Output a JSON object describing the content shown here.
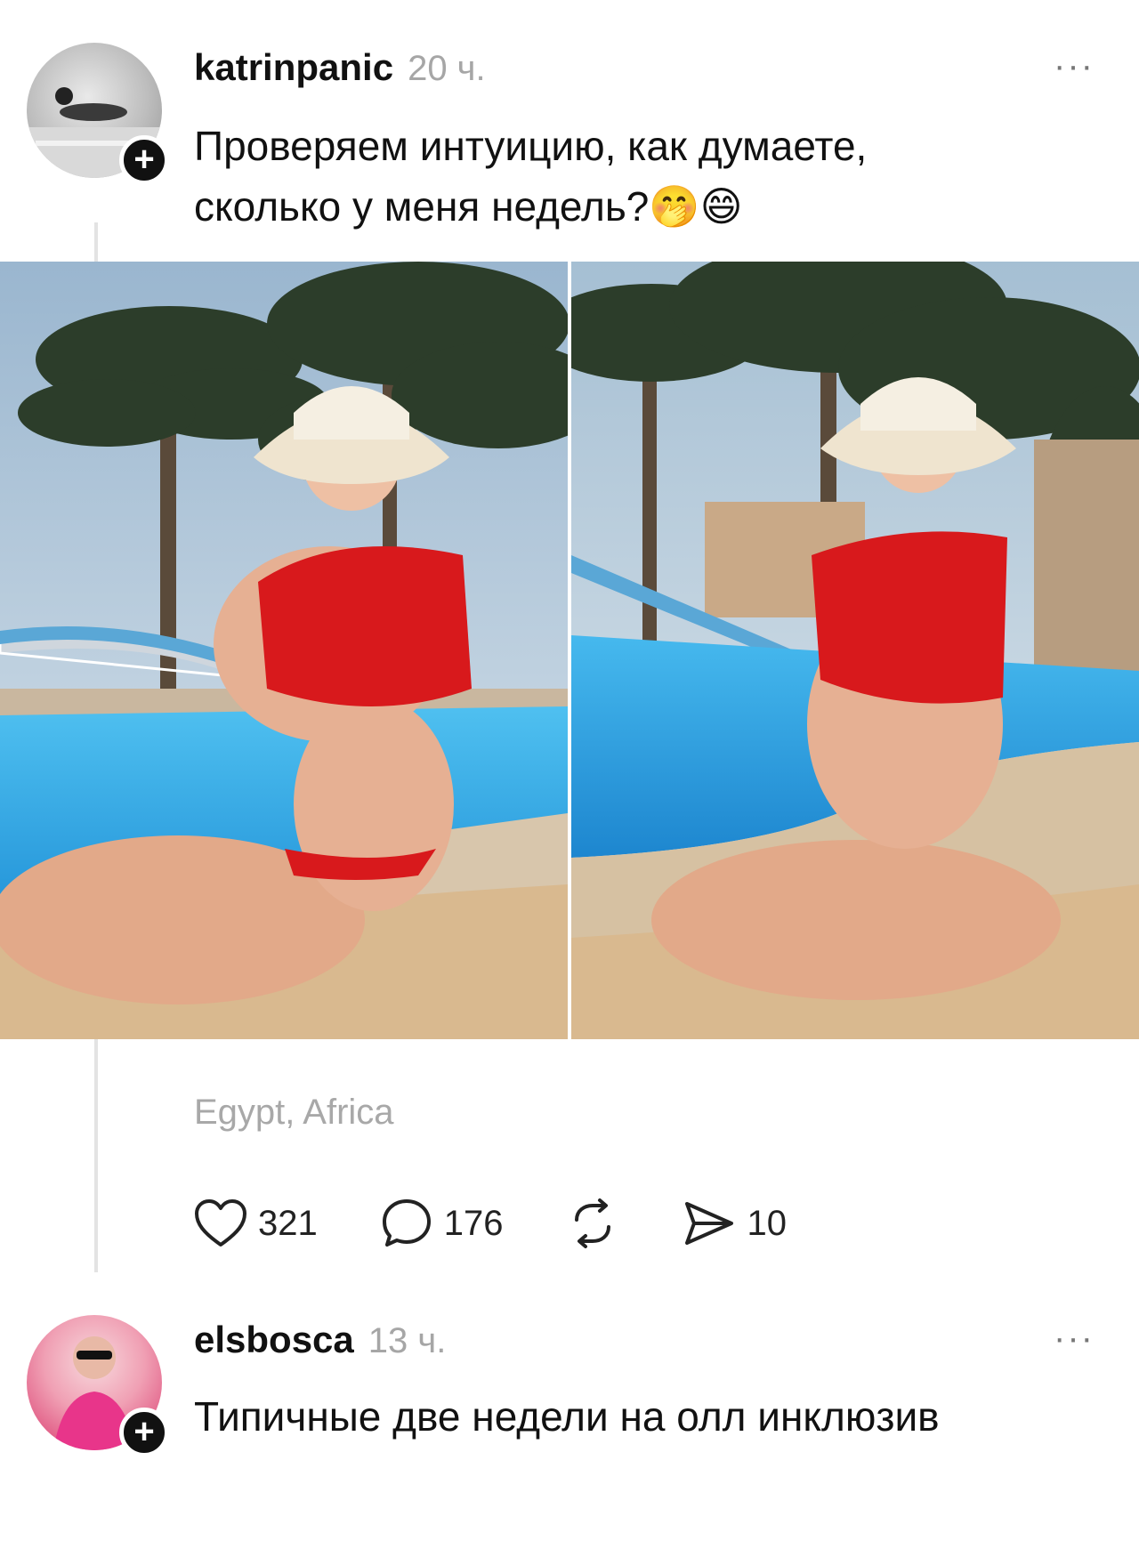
{
  "post": {
    "username": "katrinpanic",
    "time": "20 ч.",
    "text_line1": "Проверяем интуицию, как думаете,",
    "text_line2": "сколько у меня недель?",
    "emoji": "🤭😄",
    "location": "Egypt, Africa",
    "likes": "321",
    "comments": "176",
    "shares": "10",
    "more": "···",
    "follow": "+"
  },
  "reply": {
    "username": "elsbosca",
    "time": "13 ч.",
    "text": "Типичные две недели на олл инклюзив",
    "more": "···",
    "follow": "+"
  },
  "icons": [
    "heart-icon",
    "comment-icon",
    "repost-icon",
    "send-icon"
  ],
  "colors": {
    "time": "#a6a6a6",
    "location": "#a8a8a8",
    "bikini": "#d8191c",
    "pool": "#2ea7e6"
  }
}
